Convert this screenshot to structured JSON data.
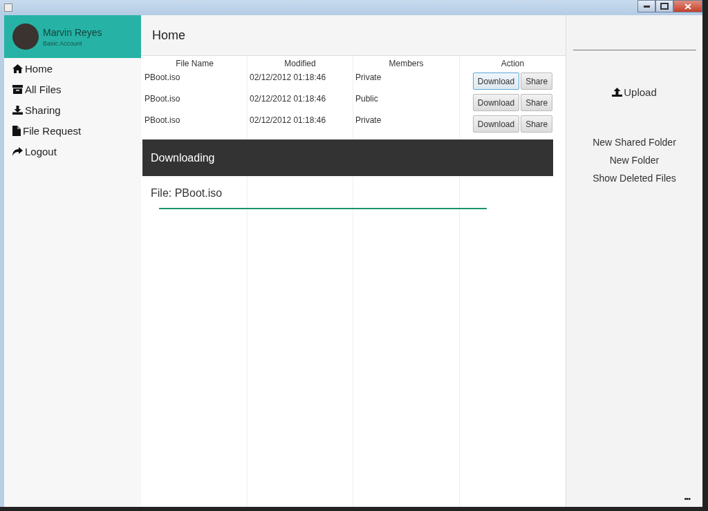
{
  "user": {
    "name": "Marvin Reyes",
    "account": "Basic Account"
  },
  "page_title": "Home",
  "nav": [
    {
      "label": "Home"
    },
    {
      "label": "All Files"
    },
    {
      "label": "Sharing"
    },
    {
      "label": "File Request"
    },
    {
      "label": "Logout"
    }
  ],
  "table": {
    "columns": [
      "File Name",
      "Modified",
      "Members",
      "Action"
    ],
    "rows": [
      {
        "file": "PBoot.iso",
        "modified": "02/12/2012 01:18:46",
        "members": "Private",
        "actions": [
          {
            "label": "Download",
            "focused": true
          },
          {
            "label": "Share",
            "focused": false
          }
        ]
      },
      {
        "file": "PBoot.iso",
        "modified": "02/12/2012 01:18:46",
        "members": "Public",
        "actions": [
          {
            "label": "Download",
            "focused": false
          },
          {
            "label": "Share",
            "focused": false
          }
        ]
      },
      {
        "file": "PBoot.iso",
        "modified": "02/12/2012 01:18:46",
        "members": "Private",
        "actions": [
          {
            "label": "Download",
            "focused": false
          },
          {
            "label": "Share",
            "focused": false
          }
        ]
      }
    ]
  },
  "download_panel": {
    "title": "Downloading",
    "file": "File: PBoot.iso"
  },
  "right_panel": {
    "upload": "Upload",
    "links": [
      "New Shared Folder",
      "New Folder",
      "Show Deleted Files"
    ],
    "more": "•••"
  }
}
